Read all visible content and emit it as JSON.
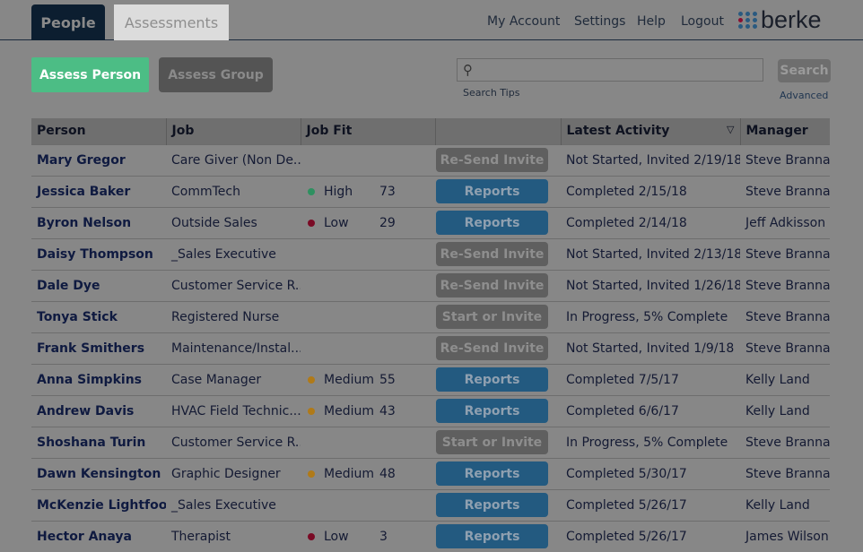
{
  "tabs": {
    "people": "People",
    "assessments": "Assessments"
  },
  "nav": {
    "my_account": "My Account",
    "settings": "Settings",
    "help": "Help",
    "logout": "Logout"
  },
  "logo": {
    "text": "berke",
    "dot_colors": [
      "#2a5a80",
      "#8a1030"
    ]
  },
  "actions": {
    "assess_person": "Assess Person",
    "assess_group": "Assess Group"
  },
  "search": {
    "placeholder": "",
    "tips": "Search Tips",
    "button": "Search",
    "advanced": "Advanced",
    "icon": "search-icon"
  },
  "colors": {
    "high": "#2e9060",
    "low": "#7a0a25",
    "medium": "#b07a18",
    "reports": "#235a80",
    "primary": "#4cbd85"
  },
  "table": {
    "headers": [
      "Person",
      "Job",
      "Job Fit",
      "",
      "Latest Activity",
      "Manager"
    ],
    "sort_icon": "▽",
    "rows": [
      {
        "person": "Mary Gregor",
        "job": "Care Giver (Non De...",
        "fit": "",
        "score": "",
        "action": "Re-Send Invite",
        "activity": "Not Started, Invited 2/19/18",
        "manager": "Steve Brannan"
      },
      {
        "person": "Jessica Baker",
        "job": "CommTech",
        "fit": "High",
        "score": "73",
        "action": "Reports",
        "activity": "Completed 2/15/18",
        "manager": "Steve Brannan"
      },
      {
        "person": "Byron Nelson",
        "job": "Outside Sales",
        "fit": "Low",
        "score": "29",
        "action": "Reports",
        "activity": "Completed 2/14/18",
        "manager": "Jeff Adkisson"
      },
      {
        "person": "Daisy Thompson",
        "job": "_Sales Executive",
        "fit": "",
        "score": "",
        "action": "Re-Send Invite",
        "activity": "Not Started, Invited 2/13/18",
        "manager": "Steve Brannan"
      },
      {
        "person": "Dale Dye",
        "job": "Customer Service R...",
        "fit": "",
        "score": "",
        "action": "Re-Send Invite",
        "activity": "Not Started, Invited 1/26/18",
        "manager": "Steve Brannan"
      },
      {
        "person": "Tonya Stick",
        "job": "Registered Nurse",
        "fit": "",
        "score": "",
        "action": "Start or Invite",
        "activity": "In Progress, 5% Complete",
        "manager": "Steve Brannan"
      },
      {
        "person": "Frank Smithers",
        "job": "Maintenance/Instal...",
        "fit": "",
        "score": "",
        "action": "Re-Send Invite",
        "activity": "Not Started, Invited 1/9/18",
        "manager": "Steve Brannan"
      },
      {
        "person": "Anna Simpkins",
        "job": "Case Manager",
        "fit": "Medium",
        "score": "55",
        "action": "Reports",
        "activity": "Completed 7/5/17",
        "manager": "Kelly Land"
      },
      {
        "person": "Andrew Davis",
        "job": "HVAC Field Technic...",
        "fit": "Medium",
        "score": "43",
        "action": "Reports",
        "activity": "Completed 6/6/17",
        "manager": "Kelly Land"
      },
      {
        "person": "Shoshana Turin",
        "job": "Customer Service R...",
        "fit": "",
        "score": "",
        "action": "Start or Invite",
        "activity": "In Progress, 5% Complete",
        "manager": "Steve Brannan"
      },
      {
        "person": "Dawn Kensington",
        "job": "Graphic Designer",
        "fit": "Medium",
        "score": "48",
        "action": "Reports",
        "activity": "Completed 5/30/17",
        "manager": "Steve Brannan"
      },
      {
        "person": "McKenzie Lightfoot",
        "job": "_Sales Executive",
        "fit": "",
        "score": "",
        "action": "Reports",
        "activity": "Completed 5/26/17",
        "manager": "Kelly Land"
      },
      {
        "person": "Hector Anaya",
        "job": "Therapist",
        "fit": "Low",
        "score": "3",
        "action": "Reports",
        "activity": "Completed 5/26/17",
        "manager": "James Wilson"
      }
    ]
  }
}
